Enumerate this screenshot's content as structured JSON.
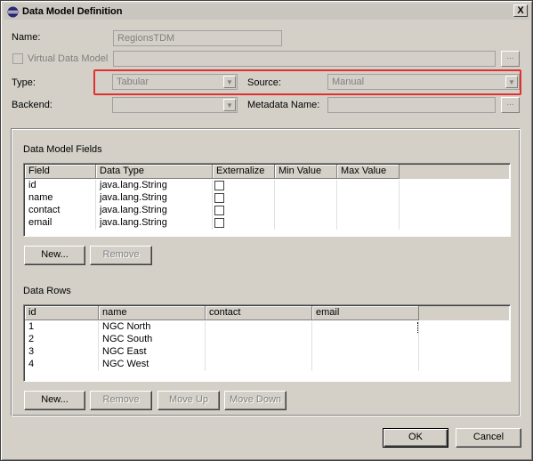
{
  "window": {
    "title": "Data Model Definition",
    "close_glyph": "X"
  },
  "form": {
    "name_label": "Name:",
    "name_value": "RegionsTDM",
    "virtual_label": "Virtual Data Model",
    "virtual_browse": "...",
    "type_label": "Type:",
    "type_value": "Tabular",
    "source_label": "Source:",
    "source_value": "Manual",
    "backend_label": "Backend:",
    "backend_value": "",
    "metadata_label": "Metadata Name:",
    "metadata_browse": "..."
  },
  "fields_section": {
    "title": "Data Model Fields",
    "columns": [
      "Field",
      "Data Type",
      "Externalize",
      "Min Value",
      "Max Value"
    ],
    "rows": [
      {
        "field": "id",
        "type": "java.lang.String"
      },
      {
        "field": "name",
        "type": "java.lang.String"
      },
      {
        "field": "contact",
        "type": "java.lang.String"
      },
      {
        "field": "email",
        "type": "java.lang.String"
      }
    ],
    "new_label": "New...",
    "remove_label": "Remove"
  },
  "rows_section": {
    "title": "Data Rows",
    "columns": [
      "id",
      "name",
      "contact",
      "email"
    ],
    "rows": [
      {
        "id": "1",
        "name": "NGC North"
      },
      {
        "id": "2",
        "name": "NGC South"
      },
      {
        "id": "3",
        "name": "NGC East"
      },
      {
        "id": "4",
        "name": "NGC West"
      }
    ],
    "new_label": "New...",
    "remove_label": "Remove",
    "move_up_label": "Move Up",
    "move_down_label": "Move Down"
  },
  "footer": {
    "ok_label": "OK",
    "cancel_label": "Cancel"
  },
  "colors": {
    "dialog_bg": "#d4d0c8",
    "highlight_border": "#e03030"
  }
}
